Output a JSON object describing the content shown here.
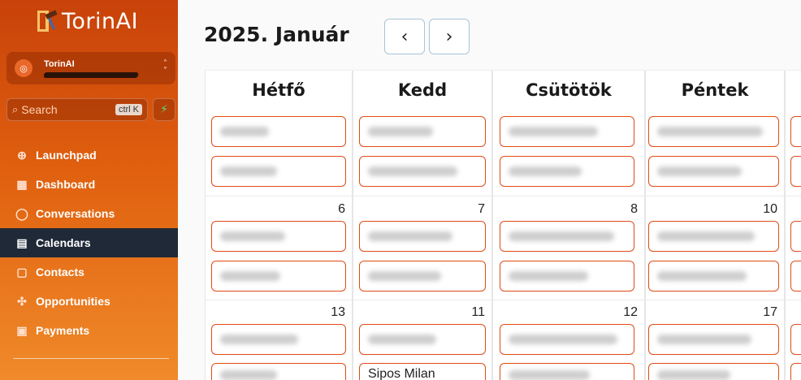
{
  "sidebar": {
    "brand": "TorinAI",
    "account": {
      "name": "TorinAI"
    },
    "search": {
      "placeholder": "Search",
      "shortcut": "ctrl K"
    },
    "items": [
      {
        "label": "Launchpad",
        "icon": "rocket-icon",
        "glyph": "⊕"
      },
      {
        "label": "Dashboard",
        "icon": "dashboard-icon",
        "glyph": "▦"
      },
      {
        "label": "Conversations",
        "icon": "chat-icon",
        "glyph": "◯"
      },
      {
        "label": "Calendars",
        "icon": "calendar-icon",
        "glyph": "▤",
        "active": true
      },
      {
        "label": "Contacts",
        "icon": "contacts-icon",
        "glyph": "▢"
      },
      {
        "label": "Opportunities",
        "icon": "opportunities-icon",
        "glyph": "✣"
      },
      {
        "label": "Payments",
        "icon": "payments-icon",
        "glyph": "▣"
      }
    ],
    "colors": {
      "gradient_top": "#c8420a",
      "gradient_bottom": "#f08a2a",
      "active_bg": "#1f2937",
      "bolt": "#4ee07a"
    }
  },
  "calendar": {
    "title": "2025. Január",
    "prev_glyph": "‹",
    "next_glyph": "›",
    "columns": [
      {
        "name": "Hétfő",
        "days": [
          "6",
          "13"
        ]
      },
      {
        "name": "Kedd",
        "days": [
          "7",
          "11"
        ]
      },
      {
        "name": "Csütötök",
        "days": [
          "8",
          "12"
        ]
      },
      {
        "name": "Péntek",
        "days": [
          "10",
          "17"
        ]
      }
    ],
    "visible_event_text": "Sipos Milan",
    "event_border_color": "#e04b16"
  }
}
